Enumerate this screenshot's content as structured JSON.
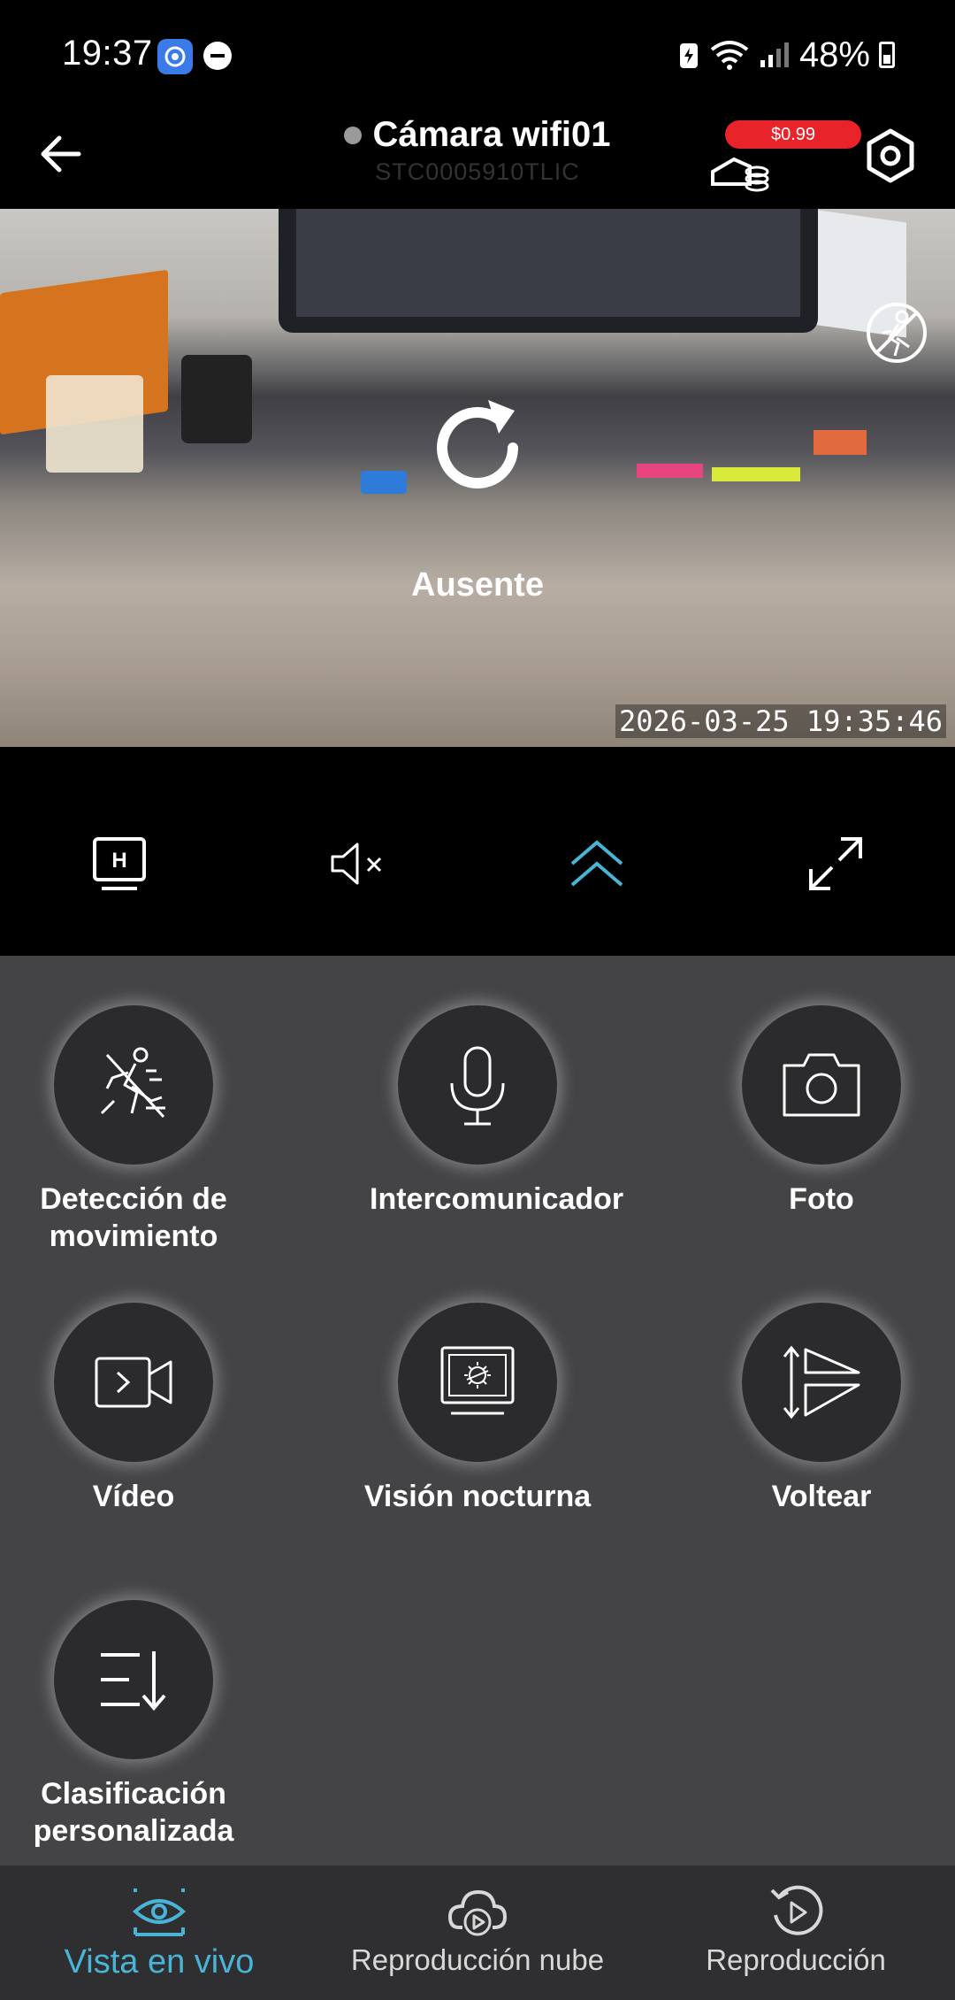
{
  "status_bar": {
    "time": "19:37",
    "battery": "48%",
    "icons": [
      "app-notification-icon",
      "do-not-disturb-icon",
      "battery-saver-icon",
      "wifi-icon",
      "signal-icon",
      "battery-icon"
    ]
  },
  "header": {
    "title": "Cámara wifi01",
    "subtitle": "STC0005910TLIC",
    "price_badge": "$0.99",
    "status_dot_color": "#9a9a9a"
  },
  "video": {
    "state_label": "Ausente",
    "timestamp": "2026-03-25  19:35:46"
  },
  "controls": {
    "items": [
      "hd-quality-icon",
      "mute-icon",
      "collapse-up-icon",
      "fullscreen-icon"
    ],
    "hd_letter": "H",
    "accent": "#48b4d6"
  },
  "features": [
    {
      "label": "Detección de movimiento",
      "icon": "motion-detection-icon"
    },
    {
      "label": "Intercomunicador",
      "icon": "microphone-icon"
    },
    {
      "label": "Foto",
      "icon": "camera-icon"
    },
    {
      "label": "Vídeo",
      "icon": "video-icon"
    },
    {
      "label": "Visión nocturna",
      "icon": "night-vision-icon"
    },
    {
      "label": "Voltear",
      "icon": "flip-icon"
    },
    {
      "label": "Clasificación personalizada",
      "icon": "custom-sort-icon"
    }
  ],
  "bottom_nav": {
    "items": [
      {
        "label": "Vista en vivo",
        "icon": "live-view-icon",
        "active": true
      },
      {
        "label": "Reproducción nube",
        "icon": "cloud-playback-icon",
        "active": false
      },
      {
        "label": "Reproducción",
        "icon": "playback-icon",
        "active": false
      }
    ]
  }
}
